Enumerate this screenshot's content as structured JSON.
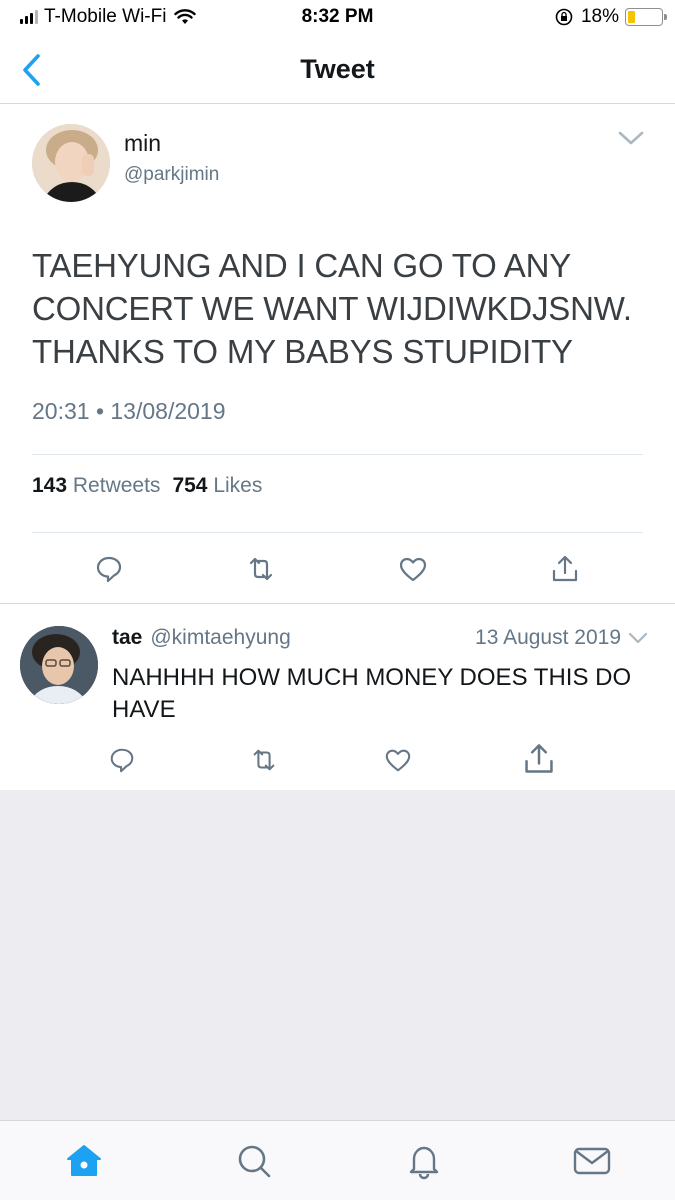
{
  "status_bar": {
    "carrier": "T-Mobile Wi-Fi",
    "time": "8:32 PM",
    "battery": "18%"
  },
  "nav": {
    "title": "Tweet"
  },
  "main_tweet": {
    "name": "min",
    "handle": "@parkjimin",
    "text": "TAEHYUNG AND I CAN GO TO ANY CONCERT WE WANT WIJDIWKDJSNW. THANKS TO MY BABYS STUPIDITY",
    "timestamp": "20:31 • 13/08/2019",
    "retweets_count": "143",
    "retweets_label": "Retweets",
    "likes_count": "754",
    "likes_label": "Likes"
  },
  "reply_tweet": {
    "name": "tae",
    "handle": "@kimtaehyung",
    "date": "13 August 2019",
    "text": "NAHHHH HOW MUCH MONEY DOES THIS DO HAVE"
  },
  "colors": {
    "accent": "#1da1f2",
    "icon_gray": "#657786",
    "divider": "#e1e8ed",
    "battery_low": "#f5c400"
  },
  "icons": {
    "back": "chevron-left-icon",
    "reply": "reply-icon",
    "retweet": "retweet-icon",
    "like": "heart-icon",
    "share": "share-icon",
    "home": "home-icon",
    "search": "search-icon",
    "notifications": "bell-icon",
    "messages": "mail-icon"
  }
}
